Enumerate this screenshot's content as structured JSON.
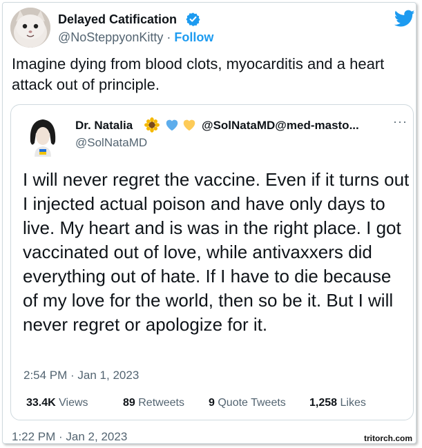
{
  "tweet": {
    "author_name": "Delayed Catification",
    "author_handle": "@NoSteppyonKitty",
    "separator": "·",
    "follow_label": "Follow",
    "text": "Imagine dying from blood clots, myocarditis and a heart attack out of principle.",
    "timestamp": "1:22 PM · Jan 2, 2023"
  },
  "quoted": {
    "name": "Dr. Natalia",
    "inline_handle": "@SolNataMD@med-masto...",
    "handle": "@SolNataMD",
    "more_label": "···",
    "text": "I will never regret the vaccine. Even if it turns out I injected actual poison and have only days to live. My heart and is was in the right place. I got vaccinated out of love, while antivaxxers did everything out of hate. If I have to die because of my love for the world, then so be it. But I will never regret or apologize for it.",
    "timestamp": "2:54 PM · Jan 1, 2023",
    "stats": {
      "views_count": "33.4K",
      "views_label": "Views",
      "retweets_count": "89",
      "retweets_label": "Retweets",
      "quotes_count": "9",
      "quotes_label": "Quote Tweets",
      "likes_count": "1,258",
      "likes_label": "Likes"
    }
  },
  "watermark": "tritorch.com",
  "colors": {
    "accent": "#1d9bf0",
    "secondary_text": "#536471",
    "border": "#cfd9de"
  },
  "icons": [
    "verified-badge-icon",
    "twitter-bird-icon",
    "sunflower-emoji-icon",
    "blue-heart-emoji-icon",
    "yellow-heart-emoji-icon",
    "more-options-icon"
  ]
}
